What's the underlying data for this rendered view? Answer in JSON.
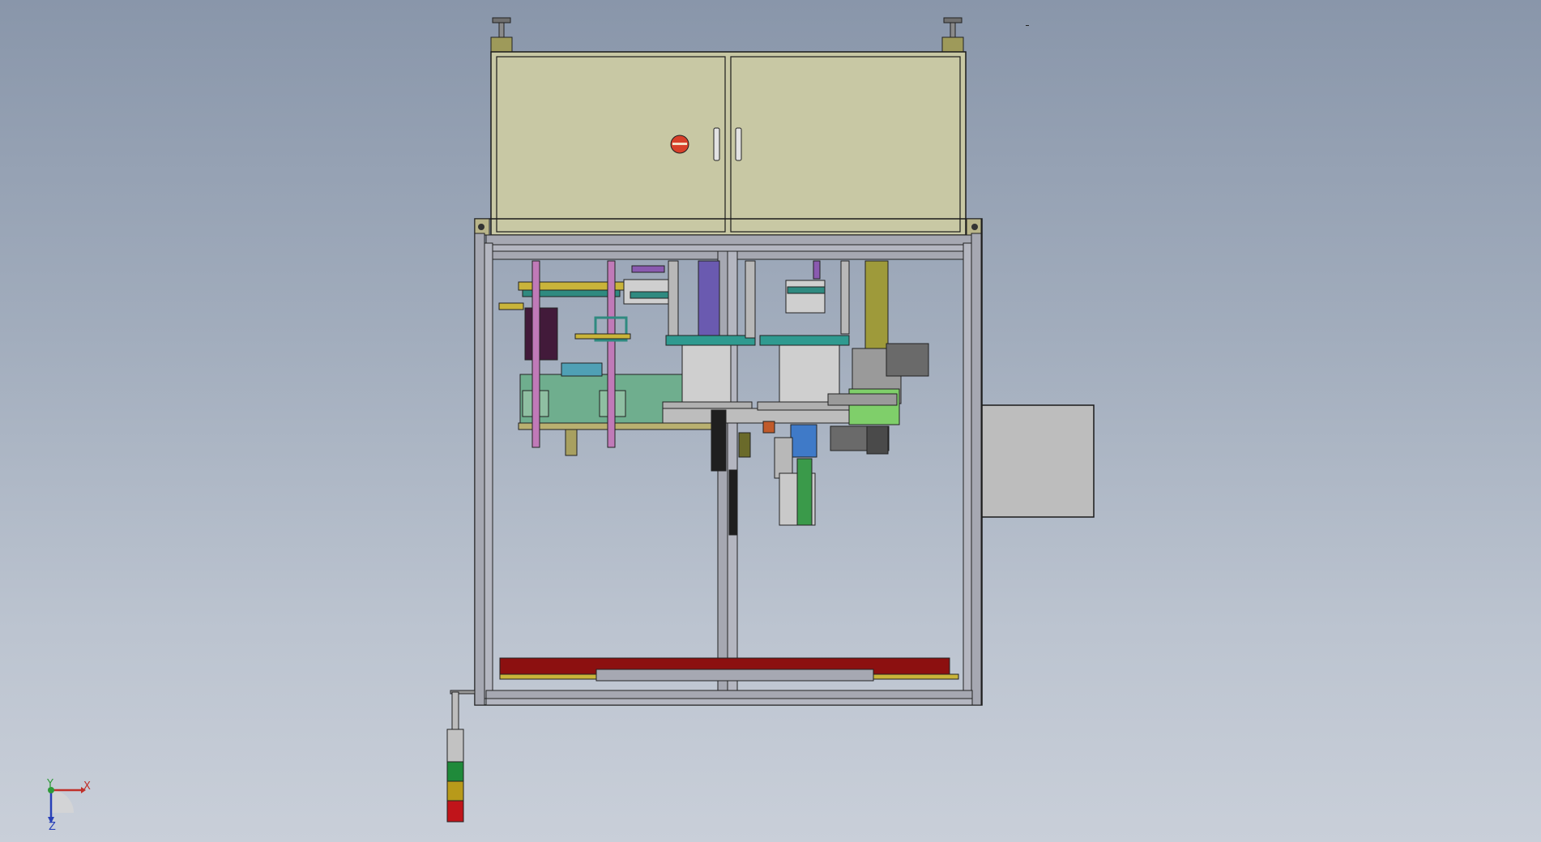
{
  "viewport": {
    "background_top": "#8996aa",
    "background_bottom": "#c9cfd9"
  },
  "axis_triad": {
    "x_label": "X",
    "y_label": "Y",
    "z_label": "Z",
    "x_color": "#c0302a",
    "y_color": "#2f9a3a",
    "z_color": "#2840b8"
  },
  "model": {
    "cabinet_color": "#c8c8a4",
    "frame_color": "#a6a8b2",
    "base_plate_color": "#8c1010",
    "side_box_color": "#bdbdbd",
    "stack_light_colors": [
      "#1f8a3a",
      "#b89a1a",
      "#c0141a"
    ]
  }
}
